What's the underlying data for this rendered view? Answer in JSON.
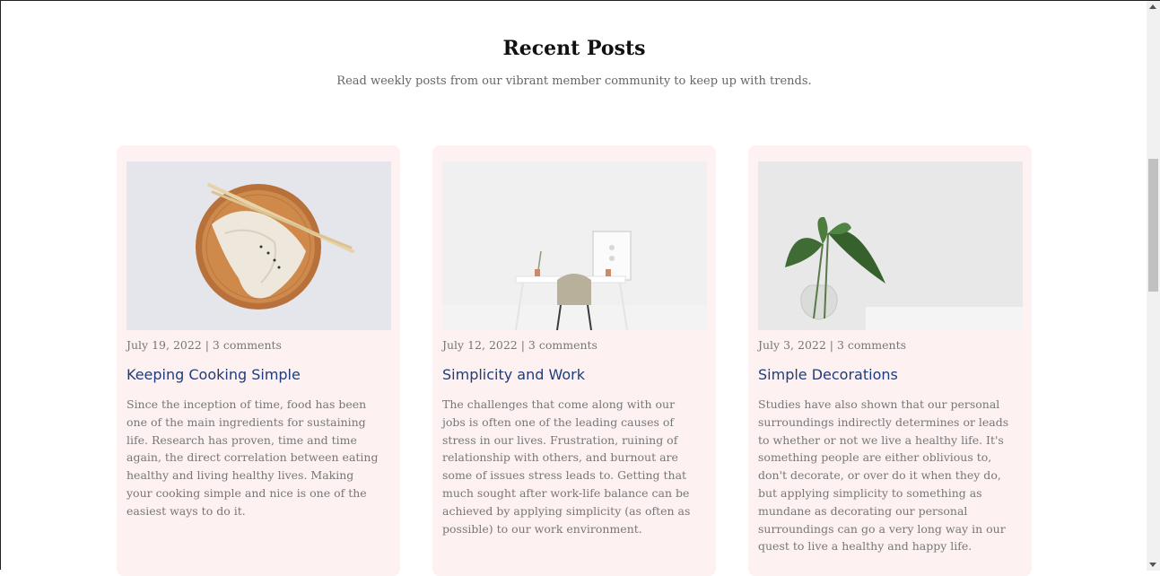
{
  "section": {
    "title": "Recent Posts",
    "subtitle": "Read weekly posts from our vibrant member community to keep up with trends."
  },
  "posts": [
    {
      "meta": "July 19, 2022 | 3 comments",
      "title": "Keeping Cooking Simple",
      "body": "Since the inception of time, food has been one of the main ingredients for sustaining life. Research has proven, time and time again, the direct correlation between eating healthy and living healthy lives. Making your cooking simple and nice is one of the easiest ways to do it.",
      "image": "dumplings-on-wooden-plate-image"
    },
    {
      "meta": "July 12, 2022 | 3 comments",
      "title": "Simplicity and Work",
      "body": "The challenges that come along with our jobs is often one of the leading causes of stress in our lives. Frustration, ruining of relationship with others, and burnout are some of issues stress leads to. Getting that much sought after work-life balance can be achieved by applying simplicity (as often as possible) to our work environment.",
      "image": "minimal-desk-chair-image"
    },
    {
      "meta": "July 3, 2022 | 3 comments",
      "title": "Simple Decorations",
      "body": "Studies have also shown that our personal surroundings indirectly determines or leads to whether or not we live a healthy life. It's something people are either oblivious to, don't decorate, or over do it when they do, but applying simplicity to something as mundane as decorating our personal surroundings can go a very long way in our quest to live a healthy and happy life.",
      "image": "plant-in-glass-vase-image"
    }
  ],
  "colors": {
    "card_bg": "#fdf1f1",
    "post_title": "#1f3c7a",
    "text_muted": "#777777"
  }
}
